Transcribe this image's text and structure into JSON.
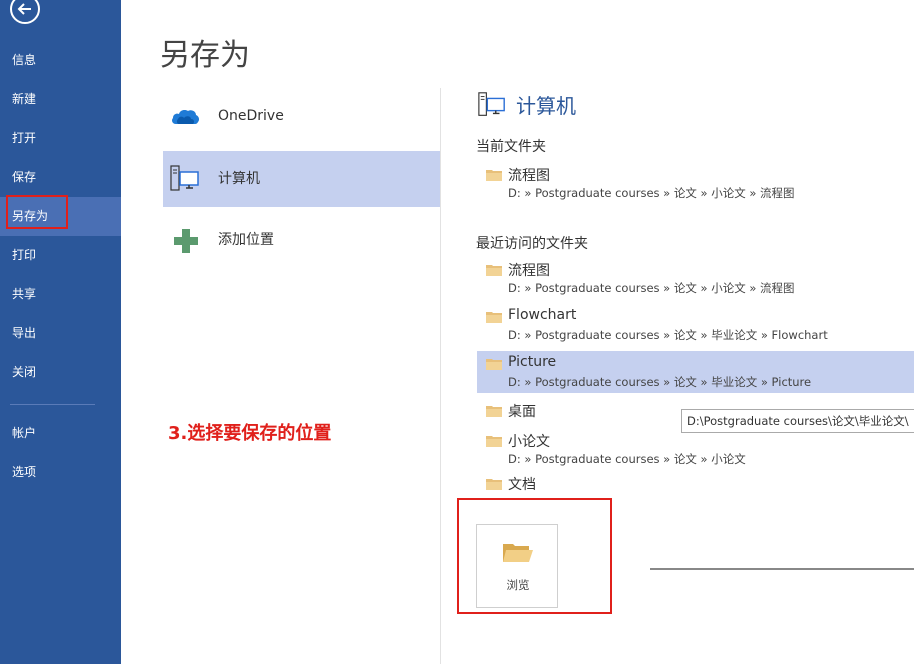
{
  "nav": {
    "items": [
      {
        "label": "信息"
      },
      {
        "label": "新建"
      },
      {
        "label": "打开"
      },
      {
        "label": "保存"
      },
      {
        "label": "另存为"
      },
      {
        "label": "打印"
      },
      {
        "label": "共享"
      },
      {
        "label": "导出"
      },
      {
        "label": "关闭"
      },
      {
        "label": "帐户"
      },
      {
        "label": "选项"
      }
    ],
    "active_index": 4
  },
  "page": {
    "title": "另存为"
  },
  "places": [
    {
      "label": "OneDrive",
      "icon": "cloud-icon"
    },
    {
      "label": "计算机",
      "icon": "computer-icon",
      "selected": true
    },
    {
      "label": "添加位置",
      "icon": "plus-icon"
    }
  ],
  "annotation": "3.选择要保存的位置",
  "computer": {
    "title": "计算机",
    "current_folder_label": "当前文件夹",
    "current_folder": {
      "name": "流程图",
      "path": "D: » Postgraduate courses » 论文 » 小论文 » 流程图"
    },
    "recent_label": "最近访问的文件夹",
    "recent": [
      {
        "name": "流程图",
        "path": "D: » Postgraduate courses » 论文 » 小论文 » 流程图"
      },
      {
        "name": "Flowchart",
        "path": "D: » Postgraduate courses » 论文 » 毕业论文 » Flowchart"
      },
      {
        "name": "Picture",
        "path": "D: » Postgraduate courses » 论文 » 毕业论文 » Picture",
        "selected": true
      },
      {
        "name": "桌面",
        "path": ""
      },
      {
        "name": "小论文",
        "path": "D: » Postgraduate courses » 论文 » 小论文"
      },
      {
        "name": "文档",
        "path": ""
      }
    ],
    "tooltip": "D:\\Postgraduate courses\\论文\\毕业论文\\",
    "browse_label": "浏览"
  },
  "colors": {
    "accent": "#2b579a",
    "selected_bg": "#c5d0ef",
    "highlight_red": "#e0201b",
    "folder": "#e8c07a"
  }
}
